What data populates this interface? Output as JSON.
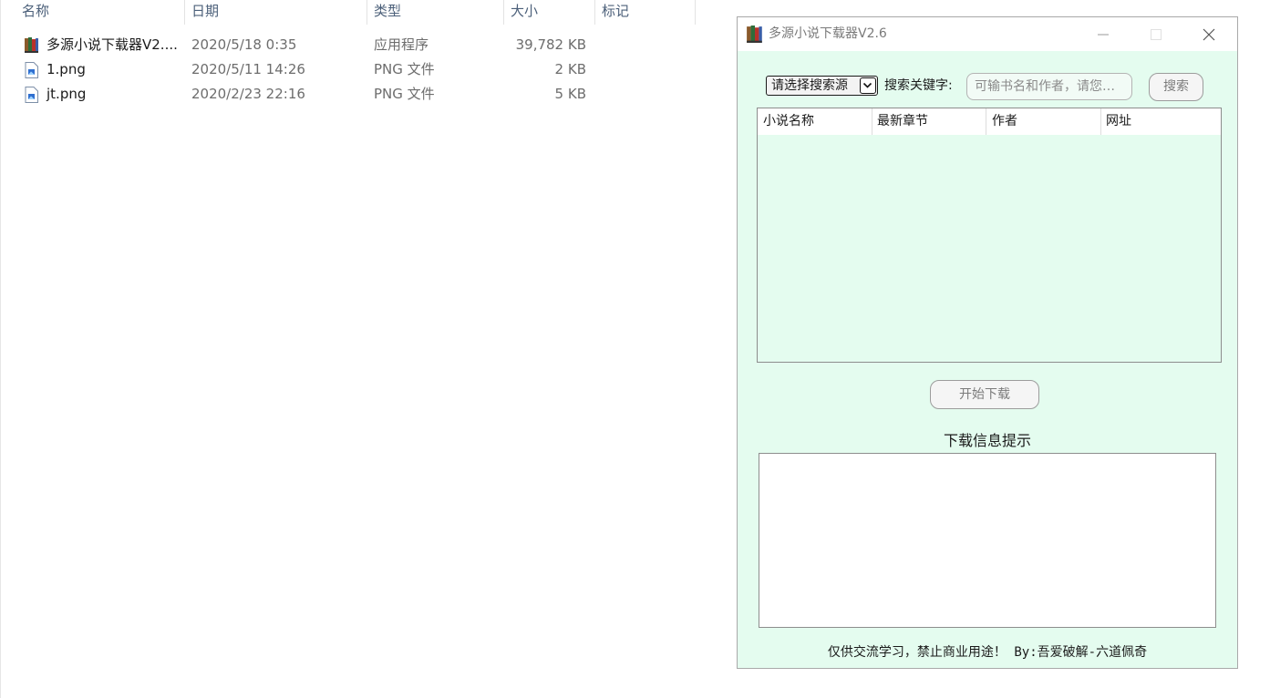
{
  "explorer": {
    "columns": [
      "名称",
      "日期",
      "类型",
      "大小",
      "标记"
    ],
    "files": [
      {
        "name": "多源小说下载器V2....",
        "date": "2020/5/18 0:35",
        "type": "应用程序",
        "size": "39,782 KB",
        "icon": "books-icon"
      },
      {
        "name": "1.png",
        "date": "2020/5/11 14:26",
        "type": "PNG 文件",
        "size": "2 KB",
        "icon": "png-file-icon"
      },
      {
        "name": "jt.png",
        "date": "2020/2/23 22:16",
        "type": "PNG 文件",
        "size": "5 KB",
        "icon": "png-file-icon"
      }
    ]
  },
  "window": {
    "title": "多源小说下载器V2.6",
    "icon": "books-icon",
    "controls": [
      "minimize-icon",
      "maximize-icon",
      "close-icon"
    ]
  },
  "search": {
    "source_select": "请选择搜索源",
    "keyword_label": "搜索关键字:",
    "keyword_placeholder": "可输书名和作者，请您…",
    "search_button": "搜索"
  },
  "results": {
    "columns": [
      "小说名称",
      "最新章节",
      "作者",
      "网址"
    ],
    "rows": []
  },
  "download_button": "开始下载",
  "info_title": "下载信息提示",
  "info_text": "",
  "footer": "仅供交流学习，禁止商业用途！ By:吾爱破解-六道佩奇",
  "colors": {
    "window_bg": "#e4fcef",
    "header_text": "#4c607a"
  }
}
